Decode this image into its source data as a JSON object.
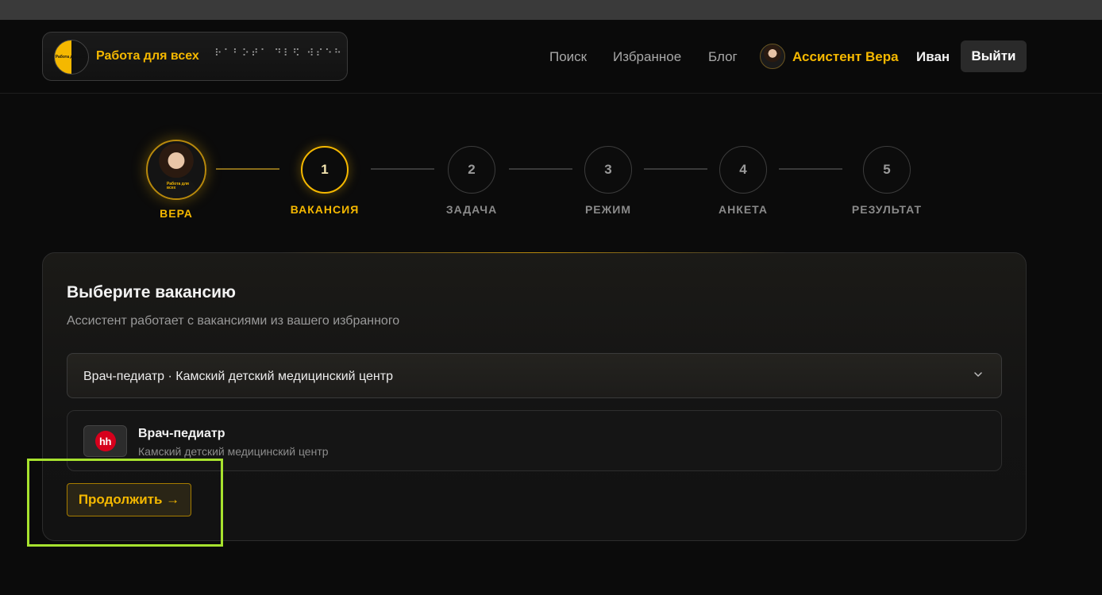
{
  "header": {
    "logo_title": "Работа для всех",
    "logo_braille": "⠗⠁⠃⠕⠞⠁ ⠙⠇⠫ ⠺⠎⠑⠓",
    "logo_badge_text": "Работа для всех",
    "nav": [
      {
        "label": "Поиск"
      },
      {
        "label": "Избранное"
      },
      {
        "label": "Блог"
      }
    ],
    "assistant_name": "Ассистент Вера",
    "user_name": "Иван",
    "logout_label": "Выйти"
  },
  "stepper": {
    "avatar_label": "ВЕРА",
    "steps": [
      {
        "number": "1",
        "label": "ВАКАНСИЯ",
        "active": true
      },
      {
        "number": "2",
        "label": "ЗАДАЧА",
        "active": false
      },
      {
        "number": "3",
        "label": "РЕЖИМ",
        "active": false
      },
      {
        "number": "4",
        "label": "АНКЕТА",
        "active": false
      },
      {
        "number": "5",
        "label": "РЕЗУЛЬТАТ",
        "active": false
      }
    ]
  },
  "card": {
    "title": "Выберите вакансию",
    "subtitle": "Ассистент работает с вакансиями из вашего избранного",
    "select_value": "Врач-педиатр · Камский детский медицинский центр",
    "vacancy": {
      "source_icon": "hh-logo",
      "source_label": "hh",
      "title": "Врач-педиатр",
      "company": "Камский детский медицинский центр"
    },
    "continue_label": "Продолжить →"
  },
  "colors": {
    "accent": "#f5b800",
    "background": "#0b0b0b",
    "highlight": "#a7e22e"
  }
}
